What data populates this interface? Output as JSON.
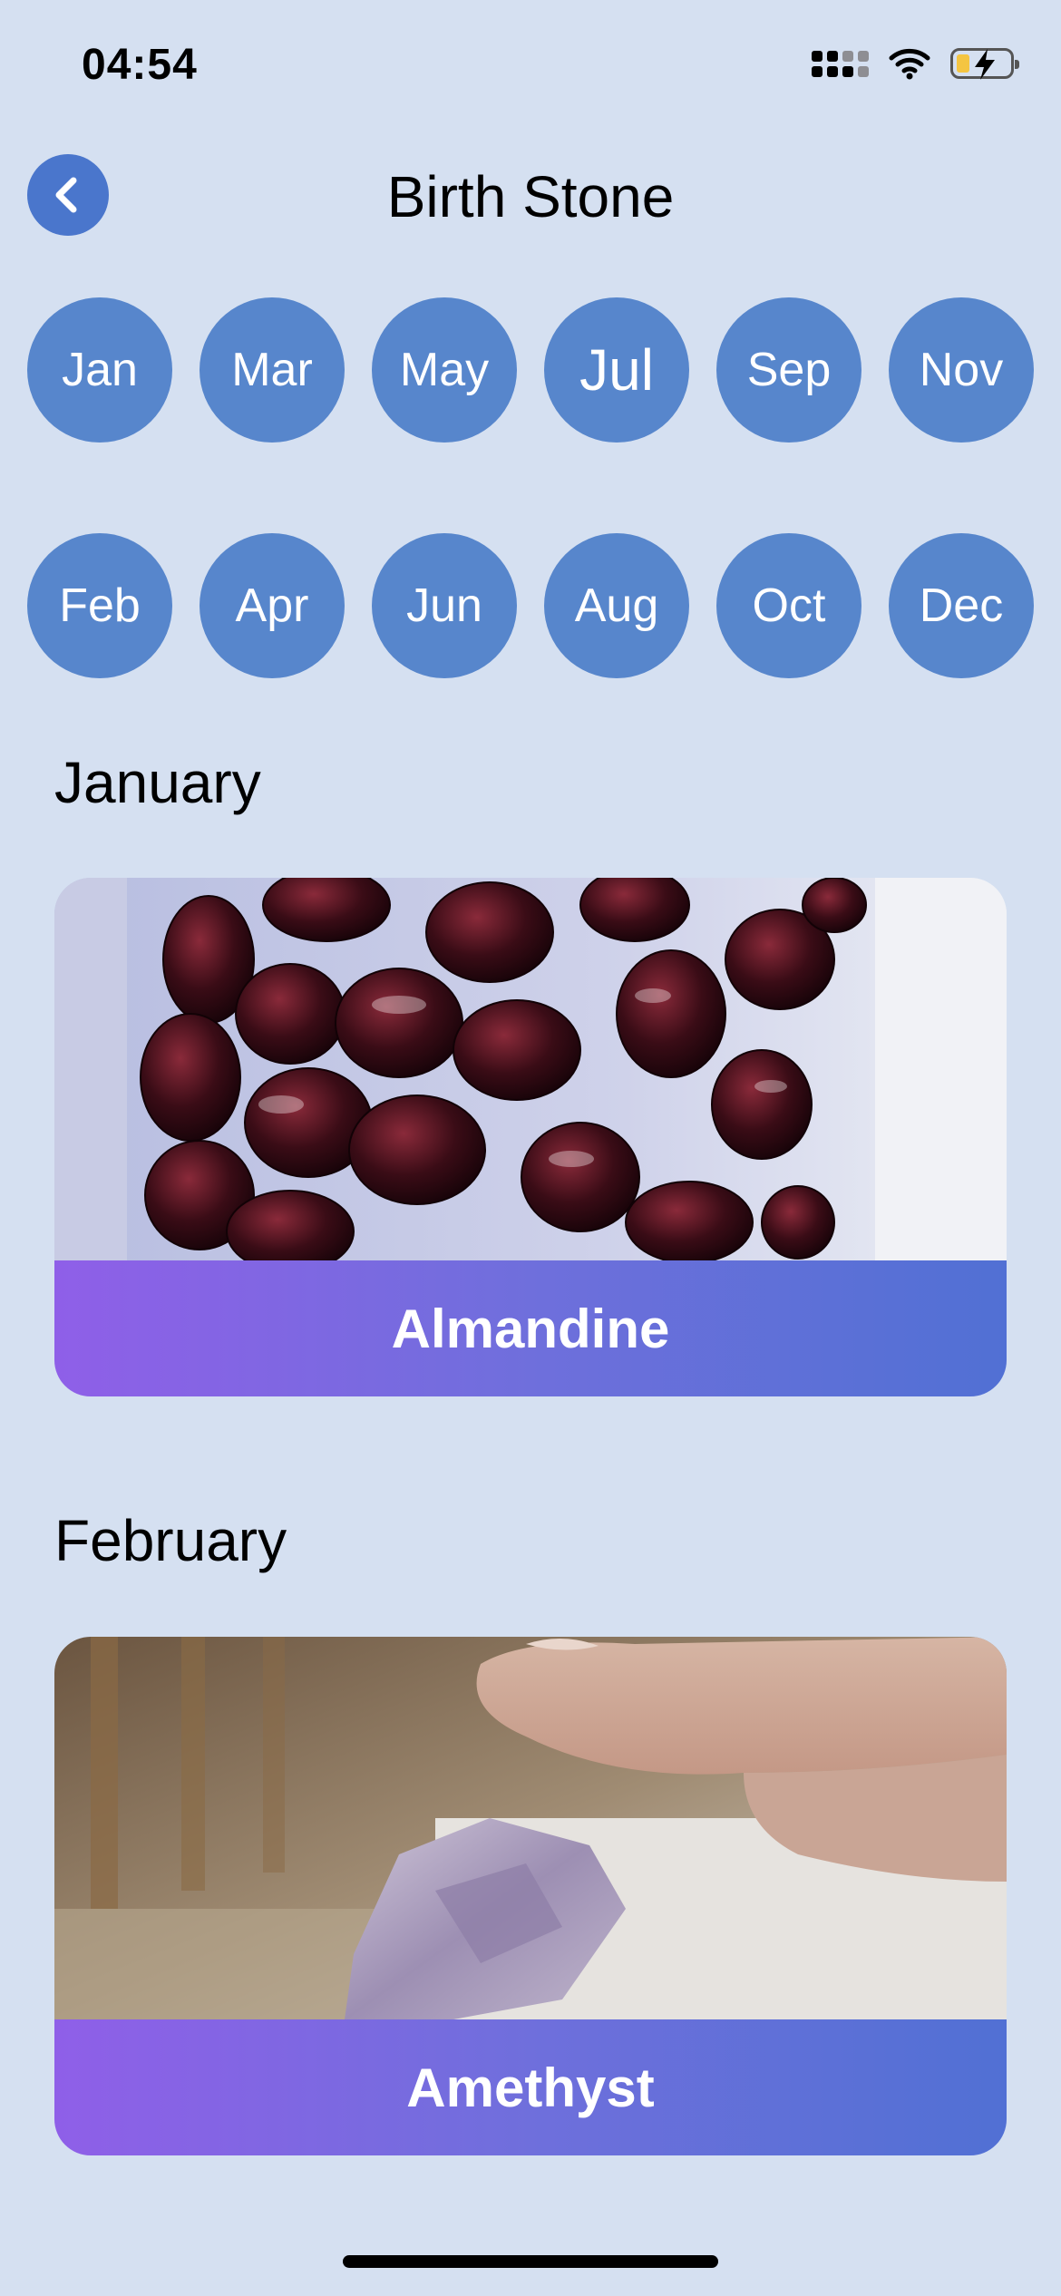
{
  "status_bar": {
    "time": "04:54"
  },
  "header": {
    "title": "Birth Stone",
    "back_icon": "chevron-left-icon"
  },
  "month_rows": [
    [
      "Jan",
      "Mar",
      "May",
      "Jul",
      "Sep",
      "Nov"
    ],
    [
      "Feb",
      "Apr",
      "Jun",
      "Aug",
      "Oct",
      "Dec"
    ]
  ],
  "sections": [
    {
      "month": "January",
      "stone": "Almandine"
    },
    {
      "month": "February",
      "stone": "Amethyst"
    }
  ],
  "colors": {
    "background": "#d5e0f1",
    "accent": "#5786cc",
    "label_gradient_start": "#8f5fe8",
    "label_gradient_end": "#5170d4"
  }
}
